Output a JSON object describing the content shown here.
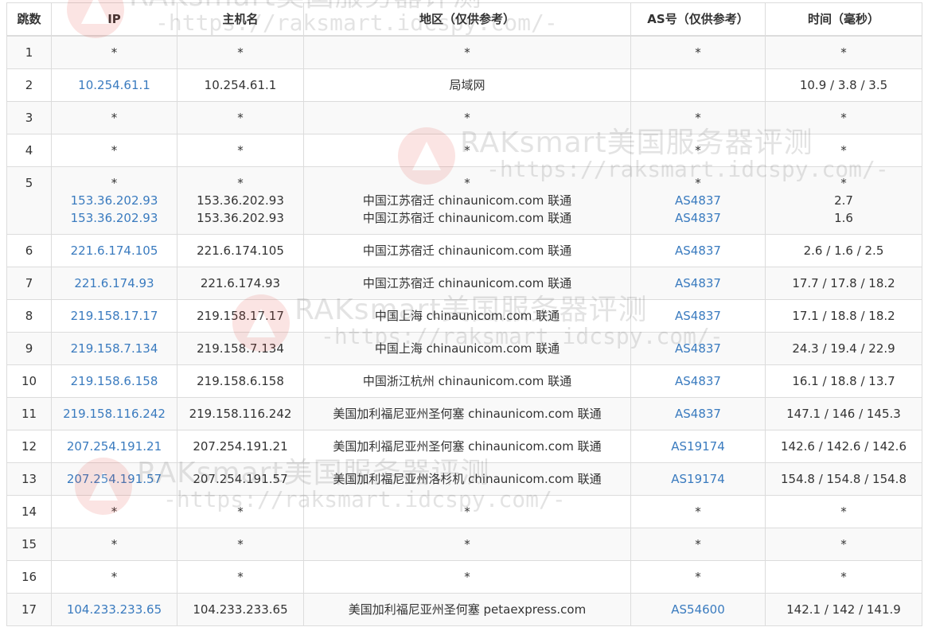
{
  "table": {
    "headers": [
      "跳数",
      "IP",
      "主机名",
      "地区（仅供参考）",
      "AS号（仅供参考）",
      "时间（毫秒）"
    ],
    "rows": [
      {
        "hop": "1",
        "ip": [
          "*"
        ],
        "host": [
          "*"
        ],
        "region": [
          "*"
        ],
        "as": [
          "*"
        ],
        "time": [
          "*"
        ]
      },
      {
        "hop": "2",
        "ip": [
          "10.254.61.1"
        ],
        "host": [
          "10.254.61.1"
        ],
        "region": [
          "局域网"
        ],
        "as": [
          ""
        ],
        "time": [
          "10.9 / 3.8 / 3.5"
        ]
      },
      {
        "hop": "3",
        "ip": [
          "*"
        ],
        "host": [
          "*"
        ],
        "region": [
          "*"
        ],
        "as": [
          "*"
        ],
        "time": [
          "*"
        ]
      },
      {
        "hop": "4",
        "ip": [
          "*"
        ],
        "host": [
          "*"
        ],
        "region": [
          "*"
        ],
        "as": [
          "*"
        ],
        "time": [
          "*"
        ]
      },
      {
        "hop": "5",
        "ip": [
          "*",
          "153.36.202.93",
          "153.36.202.93"
        ],
        "host": [
          "*",
          "153.36.202.93",
          "153.36.202.93"
        ],
        "region": [
          "*",
          "中国江苏宿迁 chinaunicom.com 联通",
          "中国江苏宿迁 chinaunicom.com 联通"
        ],
        "as": [
          "*",
          "AS4837",
          "AS4837"
        ],
        "time": [
          "*",
          "2.7",
          "1.6"
        ]
      },
      {
        "hop": "6",
        "ip": [
          "221.6.174.105"
        ],
        "host": [
          "221.6.174.105"
        ],
        "region": [
          "中国江苏宿迁 chinaunicom.com 联通"
        ],
        "as": [
          "AS4837"
        ],
        "time": [
          "2.6 / 1.6 / 2.5"
        ]
      },
      {
        "hop": "7",
        "ip": [
          "221.6.174.93"
        ],
        "host": [
          "221.6.174.93"
        ],
        "region": [
          "中国江苏宿迁 chinaunicom.com 联通"
        ],
        "as": [
          "AS4837"
        ],
        "time": [
          "17.7 / 17.8 / 18.2"
        ]
      },
      {
        "hop": "8",
        "ip": [
          "219.158.17.17"
        ],
        "host": [
          "219.158.17.17"
        ],
        "region": [
          "中国上海 chinaunicom.com 联通"
        ],
        "as": [
          "AS4837"
        ],
        "time": [
          "17.1 / 18.8 / 18.2"
        ]
      },
      {
        "hop": "9",
        "ip": [
          "219.158.7.134"
        ],
        "host": [
          "219.158.7.134"
        ],
        "region": [
          "中国上海 chinaunicom.com 联通"
        ],
        "as": [
          "AS4837"
        ],
        "time": [
          "24.3 / 19.4 / 22.9"
        ]
      },
      {
        "hop": "10",
        "ip": [
          "219.158.6.158"
        ],
        "host": [
          "219.158.6.158"
        ],
        "region": [
          "中国浙江杭州 chinaunicom.com 联通"
        ],
        "as": [
          "AS4837"
        ],
        "time": [
          "16.1 / 18.8 / 13.7"
        ]
      },
      {
        "hop": "11",
        "ip": [
          "219.158.116.242"
        ],
        "host": [
          "219.158.116.242"
        ],
        "region": [
          "美国加利福尼亚州圣何塞 chinaunicom.com 联通"
        ],
        "as": [
          "AS4837"
        ],
        "time": [
          "147.1 / 146 / 145.3"
        ]
      },
      {
        "hop": "12",
        "ip": [
          "207.254.191.21"
        ],
        "host": [
          "207.254.191.21"
        ],
        "region": [
          "美国加利福尼亚州圣何塞 chinaunicom.com 联通"
        ],
        "as": [
          "AS19174"
        ],
        "time": [
          "142.6 / 142.6 / 142.6"
        ]
      },
      {
        "hop": "13",
        "ip": [
          "207.254.191.57"
        ],
        "host": [
          "207.254.191.57"
        ],
        "region": [
          "美国加利福尼亚州洛杉机 chinaunicom.com 联通"
        ],
        "as": [
          "AS19174"
        ],
        "time": [
          "154.8 / 154.8 / 154.8"
        ]
      },
      {
        "hop": "14",
        "ip": [
          "*"
        ],
        "host": [
          "*"
        ],
        "region": [
          "*"
        ],
        "as": [
          "*"
        ],
        "time": [
          "*"
        ]
      },
      {
        "hop": "15",
        "ip": [
          "*"
        ],
        "host": [
          "*"
        ],
        "region": [
          "*"
        ],
        "as": [
          "*"
        ],
        "time": [
          "*"
        ]
      },
      {
        "hop": "16",
        "ip": [
          "*"
        ],
        "host": [
          "*"
        ],
        "region": [
          "*"
        ],
        "as": [
          "*"
        ],
        "time": [
          "*"
        ]
      },
      {
        "hop": "17",
        "ip": [
          "104.233.233.65"
        ],
        "host": [
          "104.233.233.65"
        ],
        "region": [
          "美国加利福尼亚州圣何塞 petaexpress.com"
        ],
        "as": [
          "AS54600"
        ],
        "time": [
          "142.1 / 142 / 141.9"
        ]
      }
    ]
  },
  "watermark": {
    "title": "RAKsmart美国服务器评测",
    "url": "-https://raksmart.idcspy.com/-",
    "logo_icon": "raksmart-logo-icon"
  },
  "colors": {
    "link": "#3a7bbf",
    "border": "#dcdcdc",
    "stripe": "#f9f9f9",
    "text": "#333333"
  }
}
